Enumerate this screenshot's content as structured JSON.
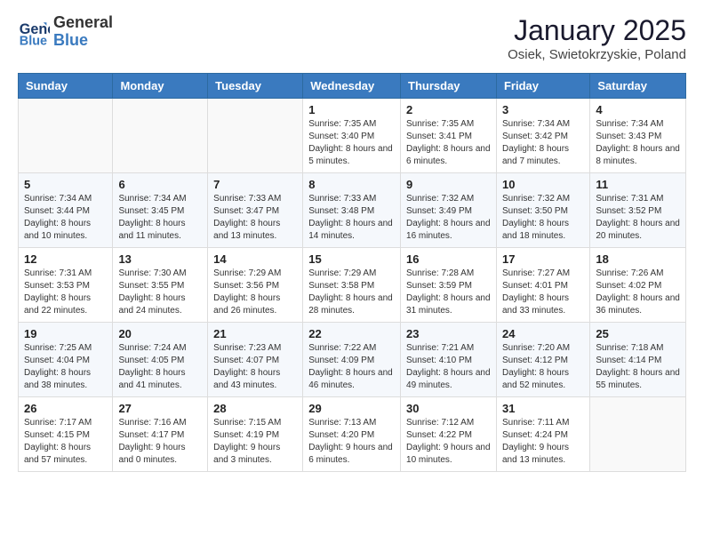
{
  "header": {
    "logo_line1": "General",
    "logo_line2": "Blue",
    "month": "January 2025",
    "location": "Osiek, Swietokrzyskie, Poland"
  },
  "weekdays": [
    "Sunday",
    "Monday",
    "Tuesday",
    "Wednesday",
    "Thursday",
    "Friday",
    "Saturday"
  ],
  "weeks": [
    [
      {
        "day": "",
        "info": ""
      },
      {
        "day": "",
        "info": ""
      },
      {
        "day": "",
        "info": ""
      },
      {
        "day": "1",
        "info": "Sunrise: 7:35 AM\nSunset: 3:40 PM\nDaylight: 8 hours and 5 minutes."
      },
      {
        "day": "2",
        "info": "Sunrise: 7:35 AM\nSunset: 3:41 PM\nDaylight: 8 hours and 6 minutes."
      },
      {
        "day": "3",
        "info": "Sunrise: 7:34 AM\nSunset: 3:42 PM\nDaylight: 8 hours and 7 minutes."
      },
      {
        "day": "4",
        "info": "Sunrise: 7:34 AM\nSunset: 3:43 PM\nDaylight: 8 hours and 8 minutes."
      }
    ],
    [
      {
        "day": "5",
        "info": "Sunrise: 7:34 AM\nSunset: 3:44 PM\nDaylight: 8 hours and 10 minutes."
      },
      {
        "day": "6",
        "info": "Sunrise: 7:34 AM\nSunset: 3:45 PM\nDaylight: 8 hours and 11 minutes."
      },
      {
        "day": "7",
        "info": "Sunrise: 7:33 AM\nSunset: 3:47 PM\nDaylight: 8 hours and 13 minutes."
      },
      {
        "day": "8",
        "info": "Sunrise: 7:33 AM\nSunset: 3:48 PM\nDaylight: 8 hours and 14 minutes."
      },
      {
        "day": "9",
        "info": "Sunrise: 7:32 AM\nSunset: 3:49 PM\nDaylight: 8 hours and 16 minutes."
      },
      {
        "day": "10",
        "info": "Sunrise: 7:32 AM\nSunset: 3:50 PM\nDaylight: 8 hours and 18 minutes."
      },
      {
        "day": "11",
        "info": "Sunrise: 7:31 AM\nSunset: 3:52 PM\nDaylight: 8 hours and 20 minutes."
      }
    ],
    [
      {
        "day": "12",
        "info": "Sunrise: 7:31 AM\nSunset: 3:53 PM\nDaylight: 8 hours and 22 minutes."
      },
      {
        "day": "13",
        "info": "Sunrise: 7:30 AM\nSunset: 3:55 PM\nDaylight: 8 hours and 24 minutes."
      },
      {
        "day": "14",
        "info": "Sunrise: 7:29 AM\nSunset: 3:56 PM\nDaylight: 8 hours and 26 minutes."
      },
      {
        "day": "15",
        "info": "Sunrise: 7:29 AM\nSunset: 3:58 PM\nDaylight: 8 hours and 28 minutes."
      },
      {
        "day": "16",
        "info": "Sunrise: 7:28 AM\nSunset: 3:59 PM\nDaylight: 8 hours and 31 minutes."
      },
      {
        "day": "17",
        "info": "Sunrise: 7:27 AM\nSunset: 4:01 PM\nDaylight: 8 hours and 33 minutes."
      },
      {
        "day": "18",
        "info": "Sunrise: 7:26 AM\nSunset: 4:02 PM\nDaylight: 8 hours and 36 minutes."
      }
    ],
    [
      {
        "day": "19",
        "info": "Sunrise: 7:25 AM\nSunset: 4:04 PM\nDaylight: 8 hours and 38 minutes."
      },
      {
        "day": "20",
        "info": "Sunrise: 7:24 AM\nSunset: 4:05 PM\nDaylight: 8 hours and 41 minutes."
      },
      {
        "day": "21",
        "info": "Sunrise: 7:23 AM\nSunset: 4:07 PM\nDaylight: 8 hours and 43 minutes."
      },
      {
        "day": "22",
        "info": "Sunrise: 7:22 AM\nSunset: 4:09 PM\nDaylight: 8 hours and 46 minutes."
      },
      {
        "day": "23",
        "info": "Sunrise: 7:21 AM\nSunset: 4:10 PM\nDaylight: 8 hours and 49 minutes."
      },
      {
        "day": "24",
        "info": "Sunrise: 7:20 AM\nSunset: 4:12 PM\nDaylight: 8 hours and 52 minutes."
      },
      {
        "day": "25",
        "info": "Sunrise: 7:18 AM\nSunset: 4:14 PM\nDaylight: 8 hours and 55 minutes."
      }
    ],
    [
      {
        "day": "26",
        "info": "Sunrise: 7:17 AM\nSunset: 4:15 PM\nDaylight: 8 hours and 57 minutes."
      },
      {
        "day": "27",
        "info": "Sunrise: 7:16 AM\nSunset: 4:17 PM\nDaylight: 9 hours and 0 minutes."
      },
      {
        "day": "28",
        "info": "Sunrise: 7:15 AM\nSunset: 4:19 PM\nDaylight: 9 hours and 3 minutes."
      },
      {
        "day": "29",
        "info": "Sunrise: 7:13 AM\nSunset: 4:20 PM\nDaylight: 9 hours and 6 minutes."
      },
      {
        "day": "30",
        "info": "Sunrise: 7:12 AM\nSunset: 4:22 PM\nDaylight: 9 hours and 10 minutes."
      },
      {
        "day": "31",
        "info": "Sunrise: 7:11 AM\nSunset: 4:24 PM\nDaylight: 9 hours and 13 minutes."
      },
      {
        "day": "",
        "info": ""
      }
    ]
  ]
}
